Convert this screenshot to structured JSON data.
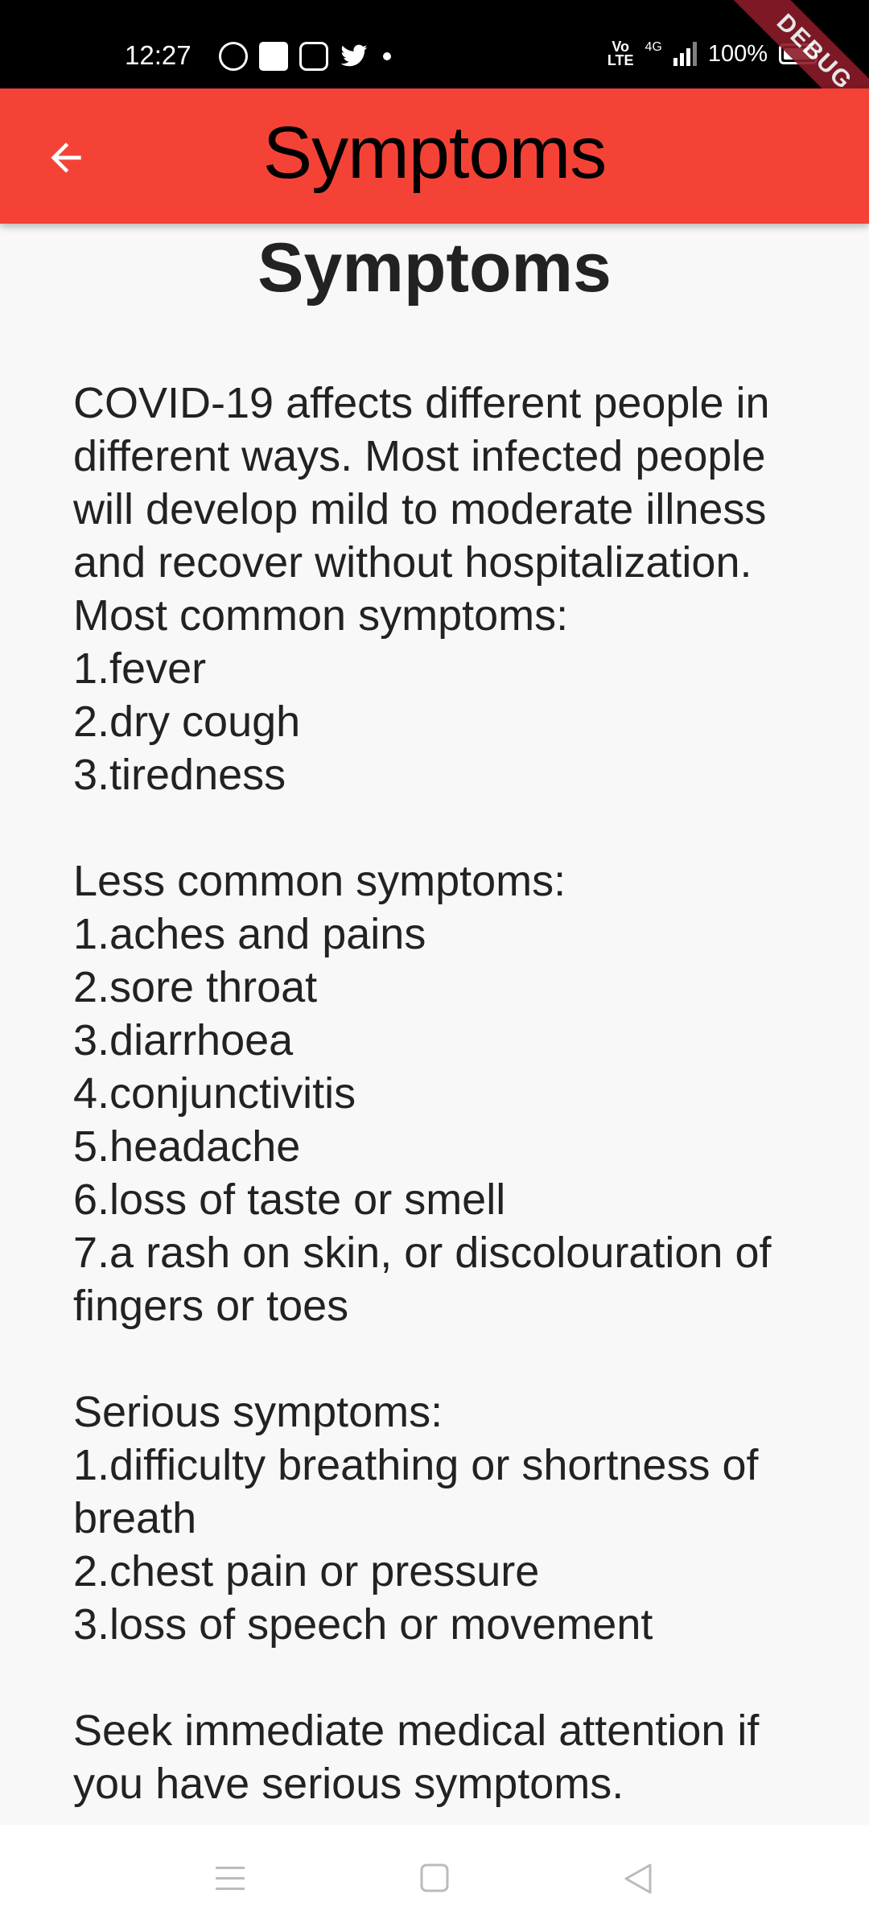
{
  "status_bar": {
    "time": "12:27",
    "network": "4G",
    "volte": "Vo\nLTE",
    "battery_text": "100%"
  },
  "debug_banner": "DEBUG",
  "app_bar": {
    "title": "Symptoms",
    "color": "#f44336"
  },
  "page": {
    "heading": "Symptoms",
    "body": "COVID-19 affects different people in different ways. Most infected people will develop mild to moderate illness and recover without hospitalization.\nMost common symptoms:\n1.fever\n2.dry cough\n3.tiredness\n\nLess common symptoms:\n1.aches and pains\n2.sore throat\n3.diarrhoea\n4.conjunctivitis\n5.headache\n6.loss of taste or smell\n7.a rash on skin, or discolouration of fingers or toes\n\nSerious symptoms:\n1.difficulty breathing or shortness of breath\n2.chest pain or pressure\n3.loss of speech or movement\n\nSeek immediate medical attention if you have serious symptoms."
  },
  "icons": {
    "back": "arrow-back-icon",
    "nav_menu": "menu-icon",
    "nav_home": "home-icon",
    "nav_back": "back-triangle-icon"
  }
}
